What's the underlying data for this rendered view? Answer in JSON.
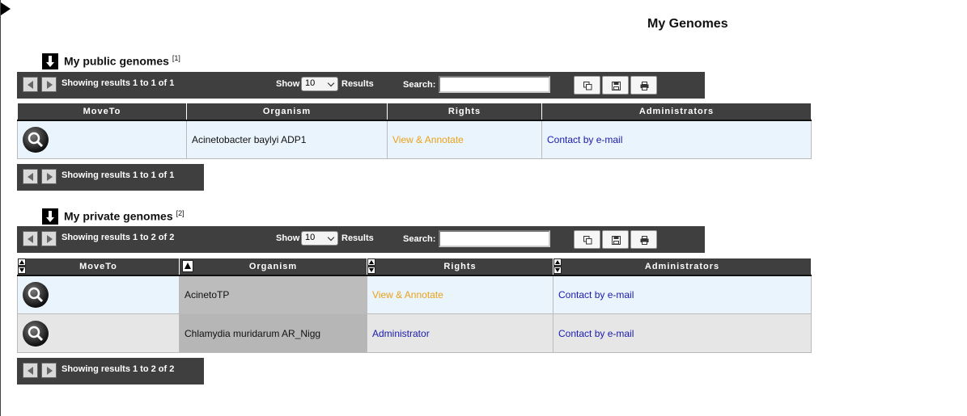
{
  "page": {
    "title": "My Genomes"
  },
  "toolbar_labels": {
    "show": "Show",
    "results": "Results",
    "search": "Search:"
  },
  "public": {
    "title": "My public genomes",
    "count_ref": "[1]",
    "info": "Showing results 1 to 1 of 1",
    "page_size": "10",
    "columns": [
      "MoveTo",
      "Organism",
      "Rights",
      "Administrators"
    ],
    "rows": [
      {
        "organism": "Acinetobacter baylyi ADP1",
        "rights": "View & Annotate",
        "admins": "Contact by e-mail"
      }
    ]
  },
  "private": {
    "title": "My private genomes",
    "count_ref": "[2]",
    "info": "Showing results 1 to 2 of 2",
    "page_size": "10",
    "columns": [
      "MoveTo",
      "Organism",
      "Rights",
      "Administrators"
    ],
    "rows": [
      {
        "organism": "AcinetoTP",
        "rights": "View & Annotate",
        "admins": "Contact by e-mail"
      },
      {
        "organism": "Chlamydia muridarum AR_Nigg",
        "rights": "Administrator",
        "admins": "Contact by e-mail"
      }
    ]
  },
  "colors": {
    "header": "#3f3f3f",
    "link": "#1a1aae",
    "annotate": "#e9a219"
  }
}
